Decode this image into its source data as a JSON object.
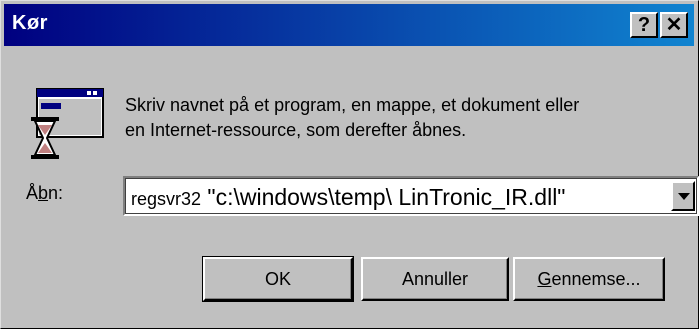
{
  "window": {
    "title": "Kør",
    "help_glyph": "?",
    "close_glyph": "✕"
  },
  "content": {
    "icon": "run-dialog-icon",
    "description_line1": "Skriv navnet på et program, en mappe, et dokument eller",
    "description_line2": "en Internet-ressource, som derefter åbnes."
  },
  "open_field": {
    "label_prefix": "Å",
    "label_accel": "b",
    "label_suffix": "n:",
    "value_command": "regsvr32",
    "value_path": " \"c:\\windows\\temp\\ LinTronic_IR.dll\""
  },
  "buttons": {
    "ok": "OK",
    "cancel": "Annuller",
    "browse_accel": "G",
    "browse_rest": "ennemse..."
  },
  "colors": {
    "title_start": "#000080",
    "title_end": "#1084d0",
    "face": "#c0c0c0"
  }
}
